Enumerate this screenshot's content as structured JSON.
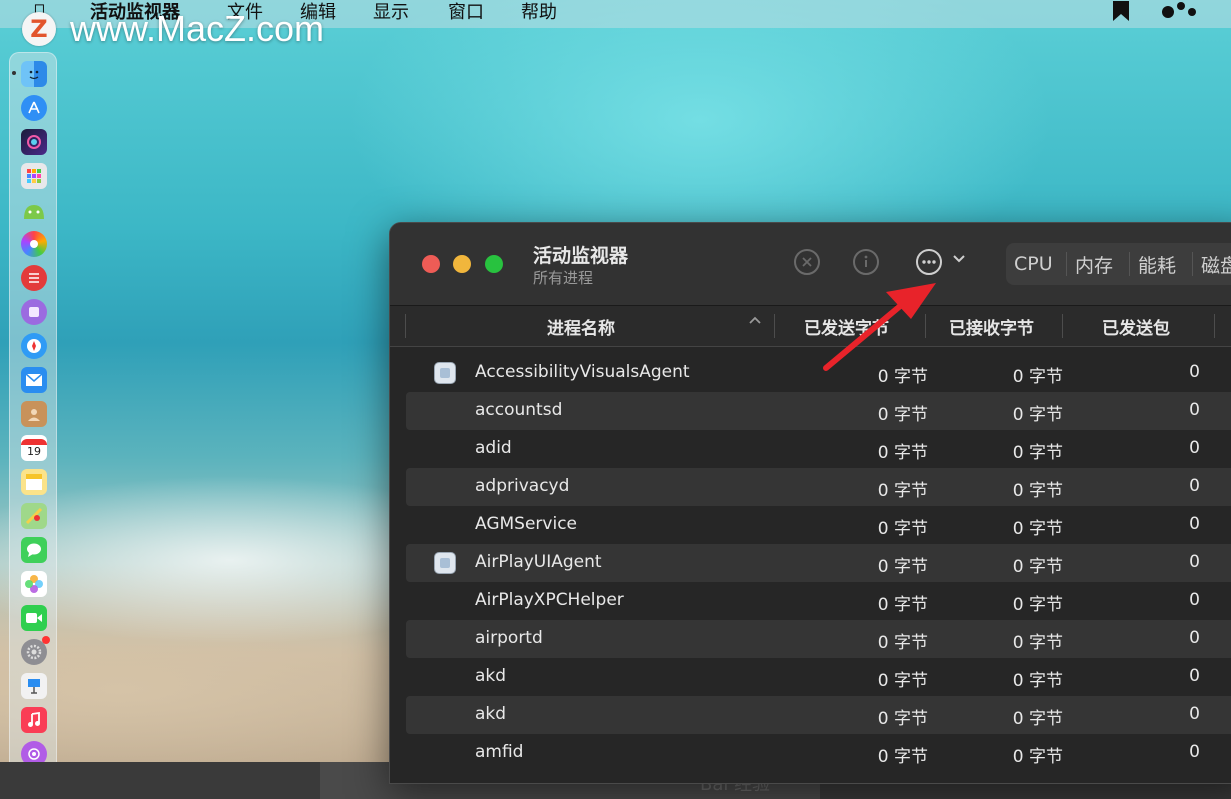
{
  "menubar": {
    "app_name": "活动监视器",
    "items": [
      "文件",
      "编辑",
      "显示",
      "窗口",
      "帮助"
    ]
  },
  "watermark": {
    "logo_letter": "Z",
    "text": "www.MacZ.com"
  },
  "dock": {
    "calendar_date": "19"
  },
  "window": {
    "title": "活动监视器",
    "subtitle": "所有进程",
    "toolbar": {
      "stop_icon": "xmark-circle-icon",
      "info_icon": "info-circle-icon",
      "more_icon": "ellipsis-circle-icon"
    },
    "tabs": [
      "CPU",
      "内存",
      "能耗",
      "磁盘"
    ]
  },
  "table": {
    "columns": [
      "进程名称",
      "已发送字节",
      "已接收字节",
      "已发送包"
    ],
    "rows": [
      {
        "name": "AccessibilityVisualsAgent",
        "sent": "0 字节",
        "recv": "0 字节",
        "packets": "0",
        "icon": true
      },
      {
        "name": "accountsd",
        "sent": "0 字节",
        "recv": "0 字节",
        "packets": "0",
        "icon": false
      },
      {
        "name": "adid",
        "sent": "0 字节",
        "recv": "0 字节",
        "packets": "0",
        "icon": false
      },
      {
        "name": "adprivacyd",
        "sent": "0 字节",
        "recv": "0 字节",
        "packets": "0",
        "icon": false
      },
      {
        "name": "AGMService",
        "sent": "0 字节",
        "recv": "0 字节",
        "packets": "0",
        "icon": false
      },
      {
        "name": "AirPlayUIAgent",
        "sent": "0 字节",
        "recv": "0 字节",
        "packets": "0",
        "icon": true
      },
      {
        "name": "AirPlayXPCHelper",
        "sent": "0 字节",
        "recv": "0 字节",
        "packets": "0",
        "icon": false
      },
      {
        "name": "airportd",
        "sent": "0 字节",
        "recv": "0 字节",
        "packets": "0",
        "icon": false
      },
      {
        "name": "akd",
        "sent": "0 字节",
        "recv": "0 字节",
        "packets": "0",
        "icon": false
      },
      {
        "name": "akd",
        "sent": "0 字节",
        "recv": "0 字节",
        "packets": "0",
        "icon": false
      },
      {
        "name": "amfid",
        "sent": "0 字节",
        "recv": "0 字节",
        "packets": "0",
        "icon": false
      }
    ]
  },
  "colors": {
    "annotation_arrow": "#e8232a",
    "window_bg": "#262626",
    "row_alt": "#353535"
  },
  "bottom_bar": {
    "blurred_text": "Bai 经验"
  }
}
